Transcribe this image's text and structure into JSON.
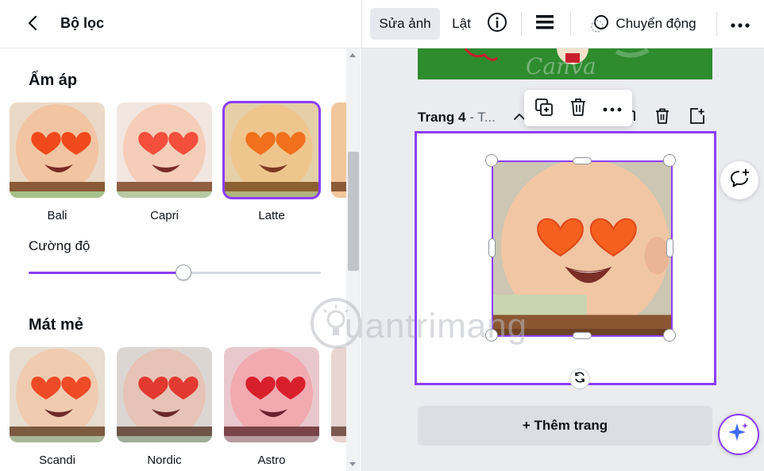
{
  "panel": {
    "title": "Bộ lọc",
    "warm_section": {
      "title": "Ấm áp",
      "filters": [
        {
          "label": "Bali",
          "selected": false
        },
        {
          "label": "Capri",
          "selected": false
        },
        {
          "label": "Latte",
          "selected": true
        }
      ]
    },
    "intensity": {
      "label": "Cường độ",
      "value_fraction": 0.53
    },
    "cool_section": {
      "title": "Mát mẻ",
      "filters": [
        {
          "label": "Scandi",
          "selected": false
        },
        {
          "label": "Nordic",
          "selected": false
        },
        {
          "label": "Astro",
          "selected": false
        }
      ]
    }
  },
  "toolbar": {
    "edit_photo": "Sửa ảnh",
    "flip": "Lật",
    "info_icon": "info-icon",
    "menu_icon": "menu-icon",
    "animate": "Chuyển động",
    "more_icon": "more-icon"
  },
  "canvas": {
    "prev_page_watermark": "Canva",
    "page_label": "Trang 4",
    "page_label_suffix": " - T...",
    "add_page": "+ Thêm trang"
  },
  "watermark": {
    "text": "uantrimang"
  },
  "colors": {
    "accent": "#8b3dff",
    "panel_bg": "#ffffff",
    "canvas_bg": "#ebecf0",
    "prev_page_green": "#2e8b2e"
  }
}
